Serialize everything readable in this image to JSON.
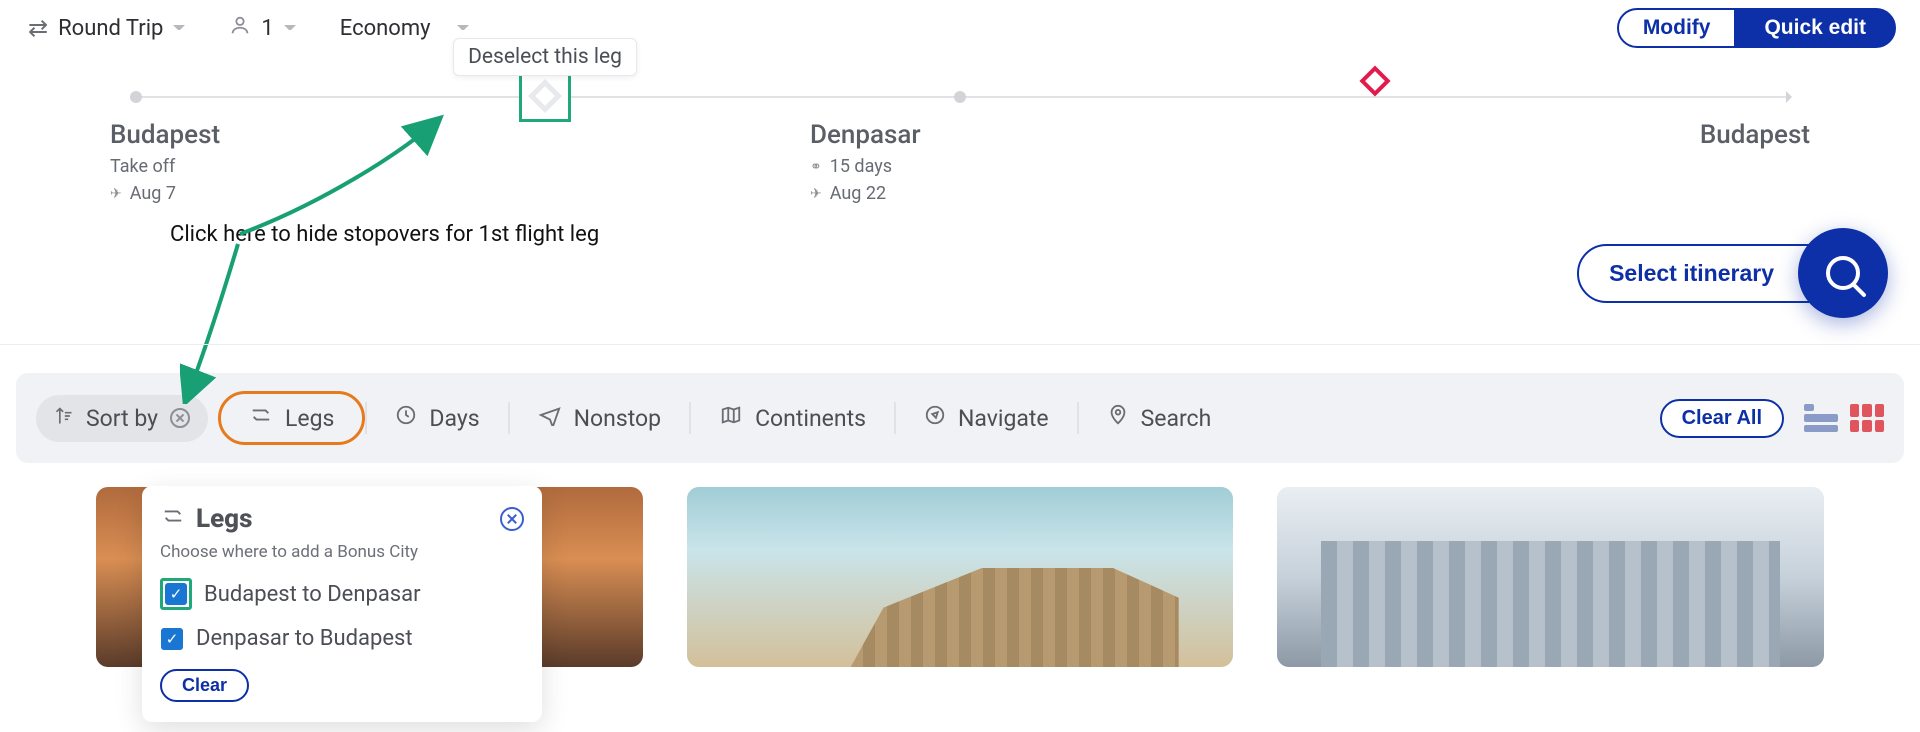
{
  "top": {
    "trip_type": "Round Trip",
    "passengers": "1",
    "cabin": "Economy",
    "modify": "Modify",
    "quick_edit": "Quick edit"
  },
  "tooltip_deselect": "Deselect this leg",
  "timeline": {
    "origin": {
      "city": "Budapest",
      "takeoff_label": "Take off",
      "date": "Aug 7"
    },
    "mid": {
      "city": "Denpasar",
      "duration": "15 days",
      "date": "Aug 22"
    },
    "dest": {
      "city": "Budapest"
    }
  },
  "annotation": "Click here to hide stopovers for 1st flight leg",
  "itinerary": {
    "select": "Select itinerary"
  },
  "filters": {
    "sortby": "Sort by",
    "legs": "Legs",
    "days": "Days",
    "nonstop": "Nonstop",
    "continents": "Continents",
    "navigate": "Navigate",
    "search": "Search",
    "clear_all": "Clear All"
  },
  "legs_pop": {
    "title": "Legs",
    "subtitle": "Choose where to add a Bonus City",
    "leg1": "Budapest to Denpasar",
    "leg2": "Denpasar to Budapest",
    "clear": "Clear"
  }
}
